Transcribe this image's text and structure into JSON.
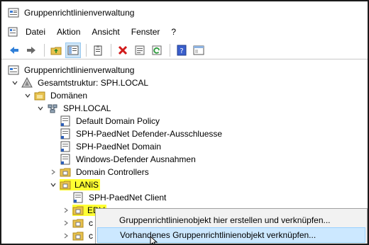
{
  "window": {
    "title": "Gruppenrichtlinienverwaltung"
  },
  "menubar": {
    "items": [
      "Datei",
      "Aktion",
      "Ansicht",
      "Fenster",
      "?"
    ]
  },
  "toolbar": {
    "buttons": [
      "back-icon",
      "forward-icon",
      "up-folder-icon",
      "show-hide-tree-icon",
      "clipboard-icon",
      "delete-icon",
      "properties-icon",
      "refresh-icon",
      "help-icon",
      "console-icon"
    ]
  },
  "tree": {
    "root": "Gruppenrichtlinienverwaltung",
    "forest": "Gesamtstruktur: SPH.LOCAL",
    "domains": "Domänen",
    "domain": "SPH.LOCAL",
    "gpo_links": [
      "Default Domain Policy",
      "SPH-PaedNet Defender-Ausschluesse",
      "SPH-PaedNet Domain",
      "Windows-Defender Ausnahmen"
    ],
    "dc_ou": "Domain Controllers",
    "lanis_ou": "LANiS",
    "lanis_gpo": "SPH-PaedNet Client",
    "edv_ou": "EDV",
    "sub1": "c",
    "sub2": "c"
  },
  "context_menu": {
    "items": [
      "Gruppenrichtlinienobjekt hier erstellen und verknüpfen...",
      "Vorhandenes Gruppenrichtlinienobjekt verknüpfen..."
    ],
    "active_index": 1
  },
  "colors": {
    "highlight": "#ffff33",
    "menu_active": "#cce8ff",
    "menu_bg": "#f2f2f2"
  }
}
